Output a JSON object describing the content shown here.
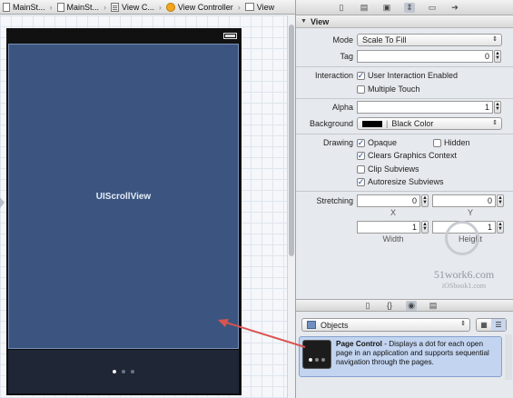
{
  "breadcrumb": [
    {
      "label": "MainSt...",
      "icon": "document-icon"
    },
    {
      "label": "MainSt...",
      "icon": "document-icon"
    },
    {
      "label": "View C...",
      "icon": "storyboard-scene-icon"
    },
    {
      "label": "View Controller",
      "icon": "view-controller-icon"
    },
    {
      "label": "View",
      "icon": "view-icon"
    }
  ],
  "canvas": {
    "scroll_view_label": "UIScrollView",
    "page_dots": 3,
    "current_page": 1
  },
  "inspector": {
    "section_title": "View",
    "mode_label": "Mode",
    "mode_value": "Scale To Fill",
    "tag_label": "Tag",
    "tag_value": "0",
    "interaction_label": "Interaction",
    "user_interaction_label": "User Interaction Enabled",
    "user_interaction_checked": true,
    "multiple_touch_label": "Multiple Touch",
    "multiple_touch_checked": false,
    "alpha_label": "Alpha",
    "alpha_value": "1",
    "background_label": "Background",
    "background_value": "Black Color",
    "drawing_label": "Drawing",
    "opaque_label": "Opaque",
    "hidden_label": "Hidden",
    "clears_label": "Clears Graphics Context",
    "clip_label": "Clip Subviews",
    "autoresize_label": "Autoresize Subviews",
    "stretching_label": "Stretching",
    "stretch_x": "0",
    "stretch_y": "0",
    "stretch_w": "1",
    "stretch_h": "1",
    "x_caption": "X",
    "y_caption": "Y",
    "width_caption": "Width",
    "height_caption": "Height"
  },
  "watermark": {
    "main": "51work6.com",
    "sub": "iOSbook1.com"
  },
  "library": {
    "filter_value": "Objects",
    "item_title": "Page Control",
    "item_description": " - Displays a dot for each open page in an application and supports sequential navigation through the pages."
  },
  "colors": {
    "scroll_view": "#3b5580",
    "callout_arrow": "#d9534f",
    "selection": "#c2d4f0"
  }
}
